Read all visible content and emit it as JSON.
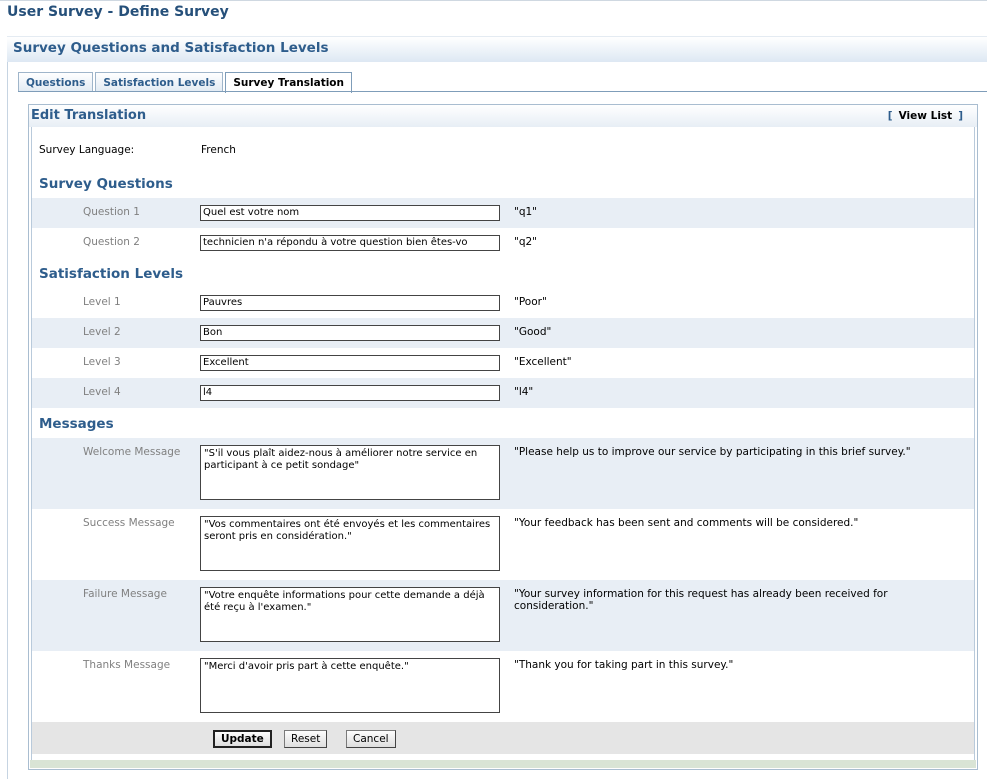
{
  "page": {
    "title": "User Survey - Define Survey"
  },
  "section": {
    "title": "Survey Questions and Satisfaction Levels"
  },
  "tabs": [
    {
      "label": "Questions"
    },
    {
      "label": "Satisfaction Levels"
    },
    {
      "label": "Survey Translation",
      "active": true
    }
  ],
  "panel": {
    "title": "Edit Translation",
    "view_list_open": "[",
    "view_list_label": "View List",
    "view_list_close": "]"
  },
  "language": {
    "label": "Survey Language:",
    "value": "French"
  },
  "questions": {
    "title": "Survey Questions",
    "rows": [
      {
        "label": "Question 1",
        "value": "Quel est votre nom",
        "original": "\"q1\""
      },
      {
        "label": "Question 2",
        "value": "technicien n'a répondu à votre question bien êtes-vo",
        "original": "\"q2\""
      }
    ]
  },
  "levels": {
    "title": "Satisfaction Levels",
    "rows": [
      {
        "label": "Level 1",
        "value": "Pauvres",
        "original": "\"Poor\""
      },
      {
        "label": "Level 2",
        "value": "Bon",
        "original": "\"Good\""
      },
      {
        "label": "Level 3",
        "value": "Excellent",
        "original": "\"Excellent\""
      },
      {
        "label": "Level 4",
        "value": "l4",
        "original": "\"l4\""
      }
    ]
  },
  "messages": {
    "title": "Messages",
    "rows": [
      {
        "label": "Welcome Message",
        "value": "\"S'il vous plaît aidez-nous à améliorer notre service en participant à ce petit sondage\"",
        "original": "\"Please help us to improve our service by participating in this brief survey.\""
      },
      {
        "label": "Success Message",
        "value": "\"Vos commentaires ont été envoyés et les commentaires seront pris en considération.\"",
        "original": "\"Your feedback has been sent and comments will be considered.\""
      },
      {
        "label": "Failure Message",
        "value": "\"Votre enquête informations pour cette demande a déjà été reçu à l'examen.\"",
        "original": "\"Your survey information for this request has already been received for consideration.\""
      },
      {
        "label": "Thanks Message",
        "value": "\"Merci d'avoir pris part à cette enquête.\"",
        "original": "\"Thank you for taking part in this survey.\""
      }
    ]
  },
  "buttons": {
    "update": "Update",
    "reset": "Reset",
    "cancel": "Cancel"
  },
  "colors": {
    "accent": "#2e5d8c",
    "shade_row": "#e8eef5",
    "label_gray": "#808080"
  }
}
